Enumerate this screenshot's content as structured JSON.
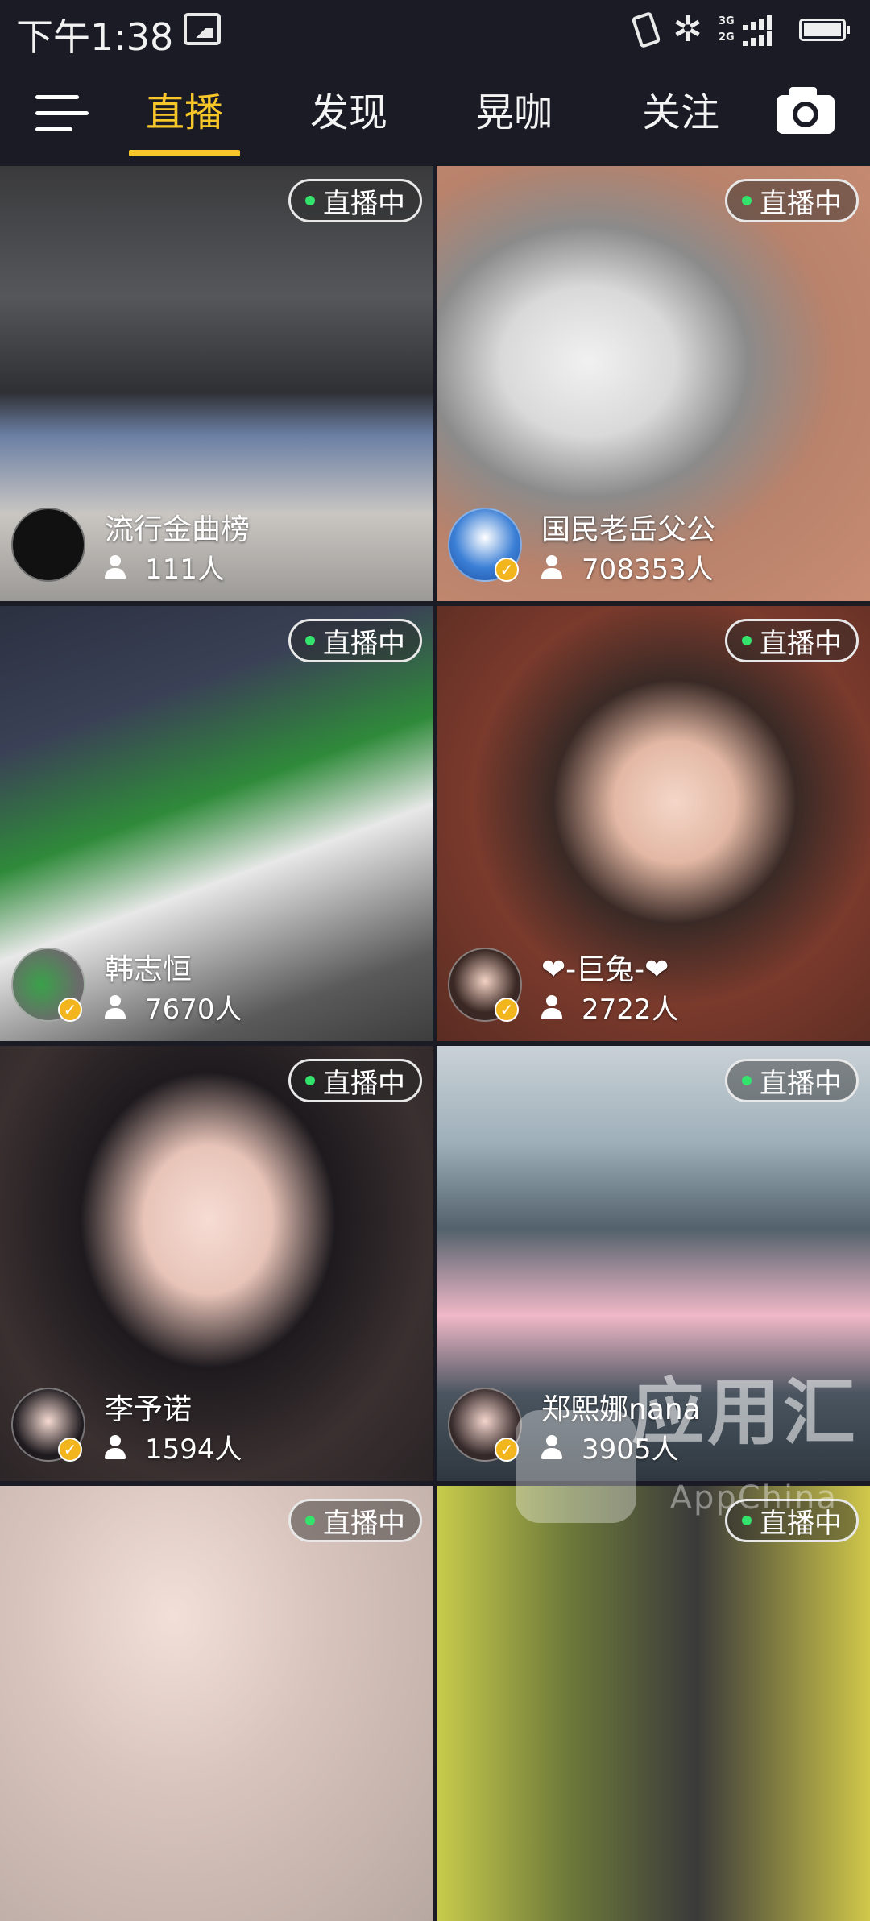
{
  "status_bar": {
    "time": "下午1:38",
    "signal_labels": [
      "3G",
      "2G"
    ]
  },
  "nav": {
    "tabs": [
      {
        "label": "直播",
        "active": true
      },
      {
        "label": "发现",
        "active": false
      },
      {
        "label": "晃咖",
        "active": false
      },
      {
        "label": "关注",
        "active": false
      }
    ]
  },
  "cards": [
    {
      "badge": "直播中",
      "host": "流行金曲榜",
      "viewers": "111人",
      "verified": false
    },
    {
      "badge": "直播中",
      "host": "国民老岳父公",
      "viewers": "708353人",
      "verified": true
    },
    {
      "badge": "直播中",
      "host": "韩志恒",
      "viewers": "7670人",
      "verified": true
    },
    {
      "badge": "直播中",
      "host": "❤-巨兔-❤",
      "viewers": "2722人",
      "verified": true
    },
    {
      "badge": "直播中",
      "host": "李予诺",
      "viewers": "1594人",
      "verified": true
    },
    {
      "badge": "直播中",
      "host": "郑熙娜nana",
      "viewers": "3905人",
      "verified": true
    },
    {
      "badge": "直播中"
    },
    {
      "badge": "直播中"
    }
  ],
  "watermark": {
    "text": "应用汇",
    "sub": "AppChina"
  },
  "colors": {
    "background": "#1b1b26",
    "accent": "#f7c72a",
    "live_dot": "#34e36b",
    "verified": "#f3b51d"
  }
}
